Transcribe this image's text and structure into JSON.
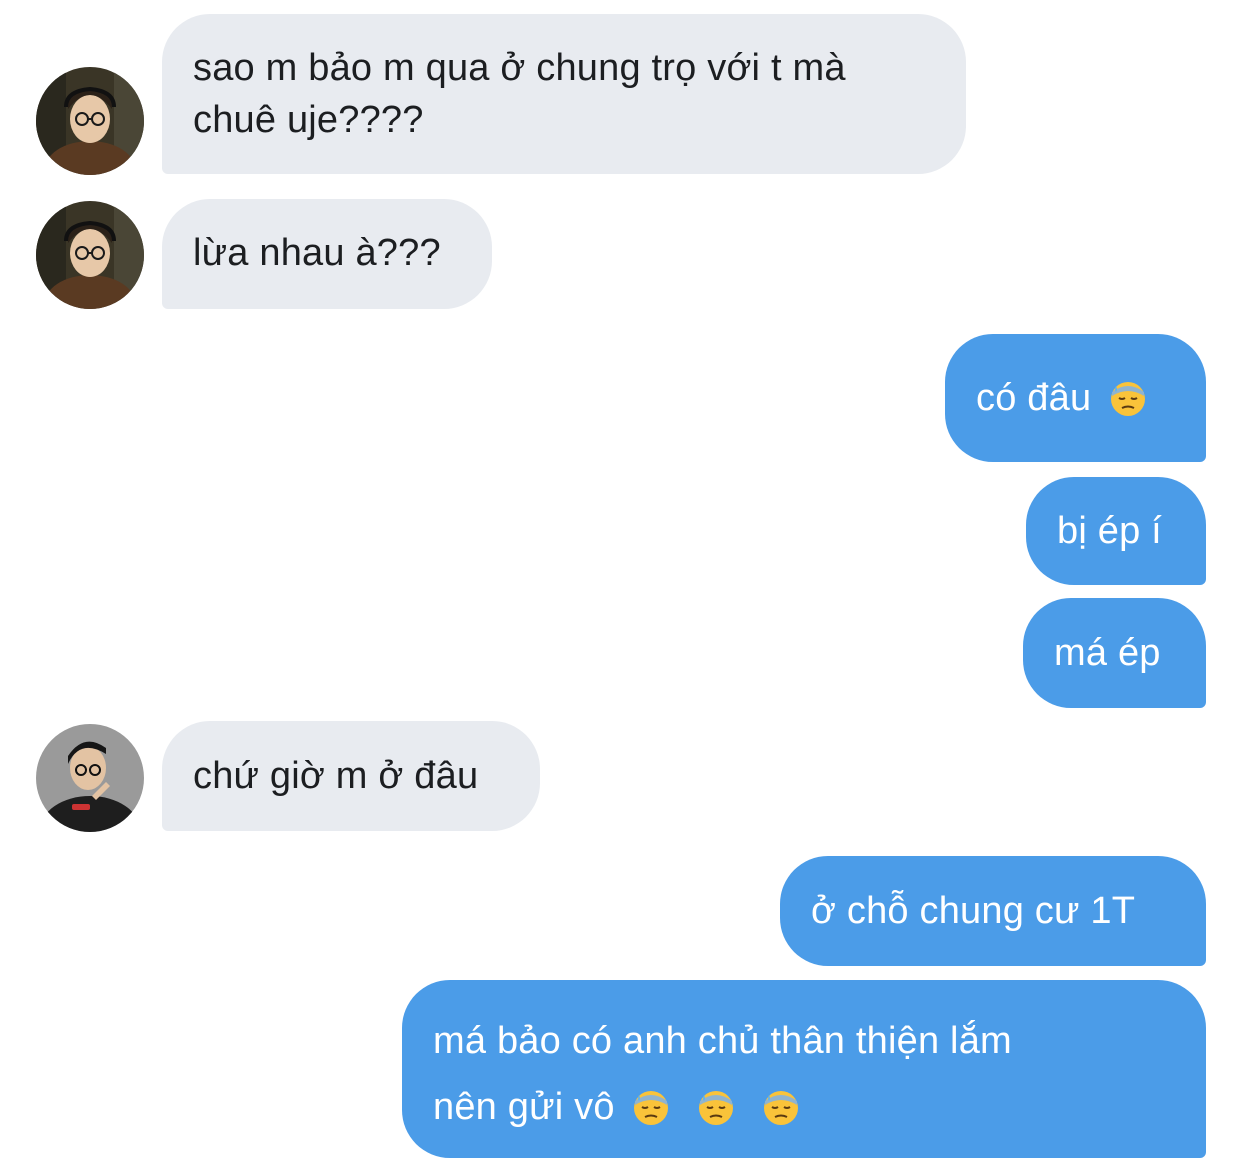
{
  "colors": {
    "incoming_bubble": "#e8ebf0",
    "outgoing_bubble": "#4b9ce8",
    "incoming_text": "#1c1e21",
    "outgoing_text": "#ffffff"
  },
  "messages": [
    {
      "direction": "incoming",
      "avatar": "user-avatar-glasses",
      "lines": [
        "sao m bảo m qua ở chung trọ với t mà",
        "chuê uje????"
      ]
    },
    {
      "direction": "incoming",
      "avatar": "user-avatar-glasses",
      "lines": [
        "lừa nhau à???"
      ]
    },
    {
      "direction": "outgoing",
      "lines": [
        "có đâu"
      ],
      "emoji": [
        "downcast-face-with-sweat-emoji"
      ]
    },
    {
      "direction": "outgoing",
      "lines": [
        "bị ép í"
      ]
    },
    {
      "direction": "outgoing",
      "lines": [
        "má ép"
      ]
    },
    {
      "direction": "incoming",
      "avatar": "user-avatar-dark-hoodie",
      "lines": [
        "chứ giờ m ở đâu"
      ]
    },
    {
      "direction": "outgoing",
      "lines": [
        "ở chỗ chung cư 1T"
      ]
    },
    {
      "direction": "outgoing",
      "lines": [
        "má bảo có anh chủ thân thiện lắm",
        "nên gửi vô"
      ],
      "emoji": [
        "downcast-face-with-sweat-emoji",
        "downcast-face-with-sweat-emoji",
        "downcast-face-with-sweat-emoji"
      ]
    }
  ]
}
